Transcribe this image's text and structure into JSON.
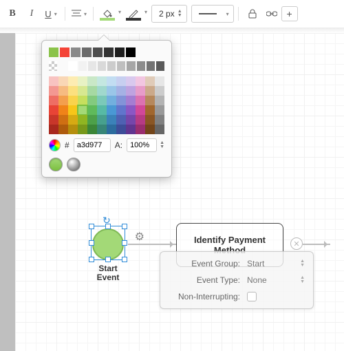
{
  "toolbar": {
    "line_weight": "2 px",
    "fill_swatch": "#a3d977",
    "stroke_swatch": "#333333"
  },
  "color_panel": {
    "hex": "a3d977",
    "hex_label": "#",
    "alpha_label": "A:",
    "alpha": "100%",
    "recent": [
      "#8bc34a",
      "#f44336",
      "#8a8a8a",
      "#6b6b6b",
      "#4d4d4d",
      "#333333",
      "#1f1f1f",
      "#000000"
    ],
    "grayrow_first": "checker",
    "grays": [
      "#ffffff",
      "#f2f2f2",
      "#e6e6e6",
      "#d9d9d9",
      "#cccccc",
      "#bfbfbf",
      "#a6a6a6",
      "#8c8c8c",
      "#737373",
      "#595959"
    ],
    "palette": [
      [
        "#f8c3c1",
        "#f9d7b6",
        "#fdecb2",
        "#e8f2c4",
        "#c9e8c7",
        "#c4e7e1",
        "#c2ddf2",
        "#c7cff0",
        "#d9c9ee",
        "#f2c6e1",
        "#e0cbb8",
        "#e6e6e6"
      ],
      [
        "#f39892",
        "#f6bb81",
        "#fbe07f",
        "#d7e891",
        "#a6d9a3",
        "#a0d8cd",
        "#9ac6e8",
        "#a5b1e4",
        "#bfa3e0",
        "#e79cc9",
        "#cba98a",
        "#cccccc"
      ],
      [
        "#ee6e64",
        "#f39f4d",
        "#f9d34c",
        "#c6df5e",
        "#83ca7f",
        "#7bc9b9",
        "#72afde",
        "#8393d8",
        "#a57dd2",
        "#dc72b1",
        "#b6885c",
        "#b3b3b3"
      ],
      [
        "#e84436",
        "#f08319",
        "#f7c619",
        "#a3d977",
        "#5fba5b",
        "#57baa5",
        "#4a98d4",
        "#6175cc",
        "#8b57c4",
        "#d14899",
        "#a1672e",
        "#999999"
      ],
      [
        "#c8362a",
        "#cf6f13",
        "#d6aa13",
        "#8fb522",
        "#4da049",
        "#47a08e",
        "#3b82b9",
        "#4f61b2",
        "#7646aa",
        "#b63b84",
        "#8a5624",
        "#808080"
      ],
      [
        "#a8281e",
        "#ae5b0d",
        "#b58e0d",
        "#77981a",
        "#3b8637",
        "#378677",
        "#2c6c9e",
        "#3d4d98",
        "#613590",
        "#9a2e6f",
        "#73451a",
        "#666666"
      ]
    ],
    "selected": {
      "row": 3,
      "col": 3
    }
  },
  "nodes": {
    "start": {
      "label_l1": "Start",
      "label_l2": "Event"
    },
    "task": {
      "label_l1": "Identify Payment",
      "label_l2": "Method"
    }
  },
  "props": {
    "event_group": {
      "label": "Event Group:",
      "value": "Start"
    },
    "event_type": {
      "label": "Event Type:",
      "value": "None"
    },
    "non_interrupting": {
      "label": "Non-Interrupting:",
      "checked": false
    }
  }
}
